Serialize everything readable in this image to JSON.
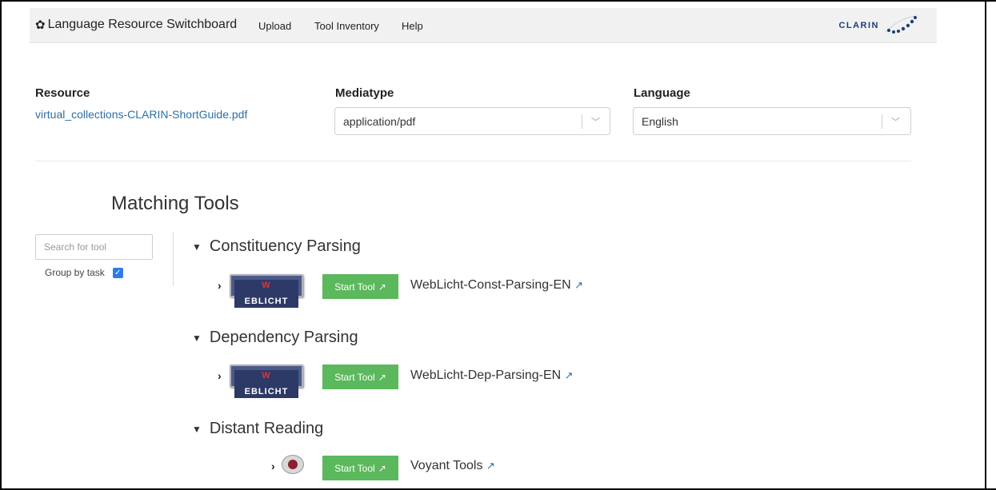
{
  "navbar": {
    "brand": "Language Resource Switchboard",
    "items": [
      "Upload",
      "Tool Inventory",
      "Help"
    ],
    "logo_text": "CLARIN"
  },
  "header": {
    "resource_label": "Resource",
    "resource_value": "virtual_collections-CLARIN-ShortGuide.pdf",
    "mediatype_label": "Mediatype",
    "mediatype_value": "application/pdf",
    "language_label": "Language",
    "language_value": "English"
  },
  "matching": {
    "title": "Matching Tools",
    "search_placeholder": "Search for tool",
    "group_by_label": "Group by task",
    "group_by_checked": true
  },
  "tasks": [
    {
      "name": "Constituency Parsing",
      "tool": "WebLicht-Const-Parsing-EN",
      "button": "Start Tool",
      "logo": "WebLicht"
    },
    {
      "name": "Dependency Parsing",
      "tool": "WebLicht-Dep-Parsing-EN",
      "button": "Start Tool",
      "logo": "WebLicht"
    },
    {
      "name": "Distant Reading",
      "tool": "Voyant Tools",
      "button": "Start Tool",
      "logo": "Voyant"
    }
  ],
  "colors": {
    "accent_link": "#2c6fa8",
    "start_button": "#5cb85c",
    "checkbox": "#2f7bea"
  }
}
